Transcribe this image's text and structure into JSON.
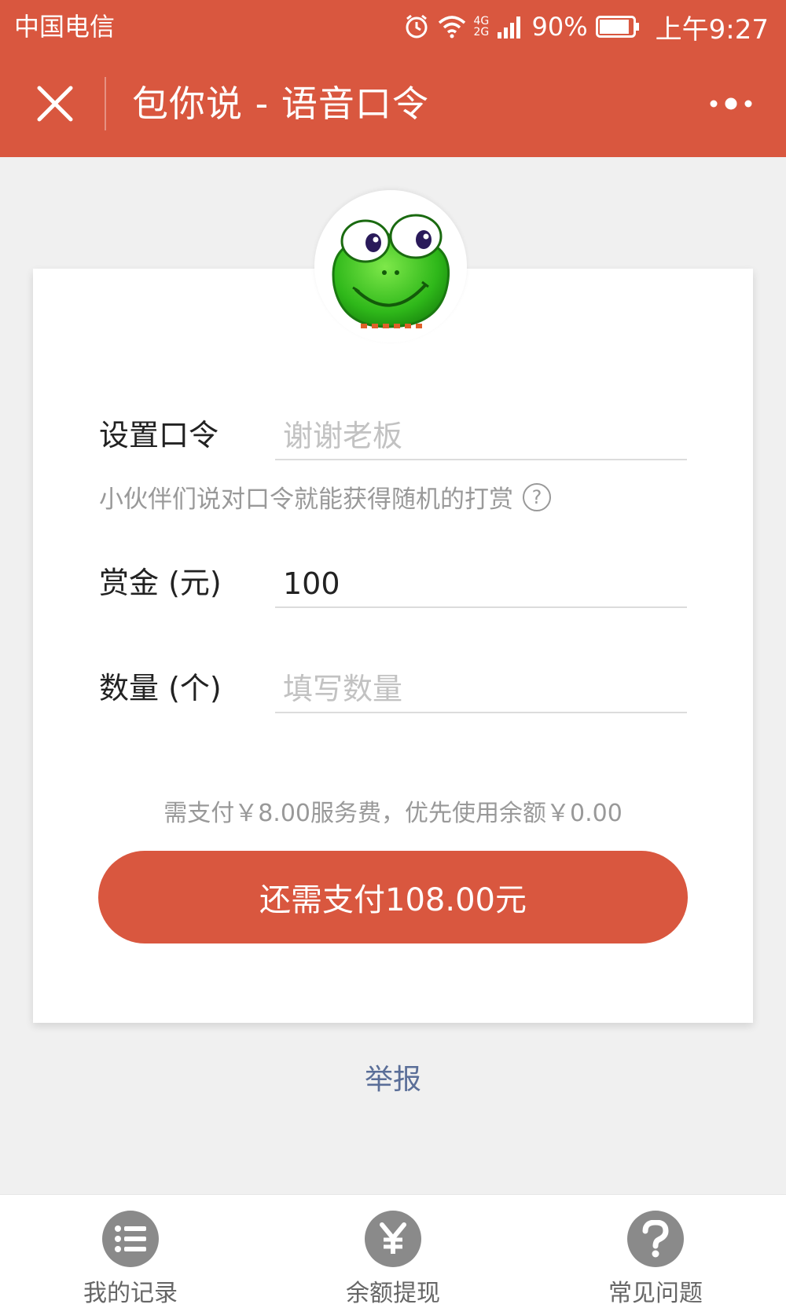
{
  "status_bar": {
    "carrier": "中国电信",
    "network": "4G 2G",
    "battery": "90%",
    "battery_level": 0.9,
    "time": "上午9:27"
  },
  "title_bar": {
    "title": "包你说 - 语音口令",
    "close_icon": "close-icon",
    "more_icon": "more-dots-icon",
    "background_color": "#d9573f"
  },
  "form": {
    "password": {
      "label": "设置口令",
      "placeholder": "谢谢老板",
      "value": ""
    },
    "hint": "小伙伴们说对口令就能获得随机的打赏",
    "amount": {
      "label": "赏金 (元)",
      "value": "100"
    },
    "count": {
      "label": "数量 (个)",
      "placeholder": "填写数量",
      "value": ""
    }
  },
  "payment": {
    "fee_note": "需支付￥8.00服务费，优先使用余额￥0.00",
    "pay_button": "还需支付108.00元",
    "accent_color": "#d9573f"
  },
  "report_link": "举报",
  "bottom_nav": [
    {
      "label": "我的记录",
      "icon": "list-icon"
    },
    {
      "label": "余额提现",
      "icon": "yen-icon"
    },
    {
      "label": "常见问题",
      "icon": "question-icon"
    }
  ]
}
